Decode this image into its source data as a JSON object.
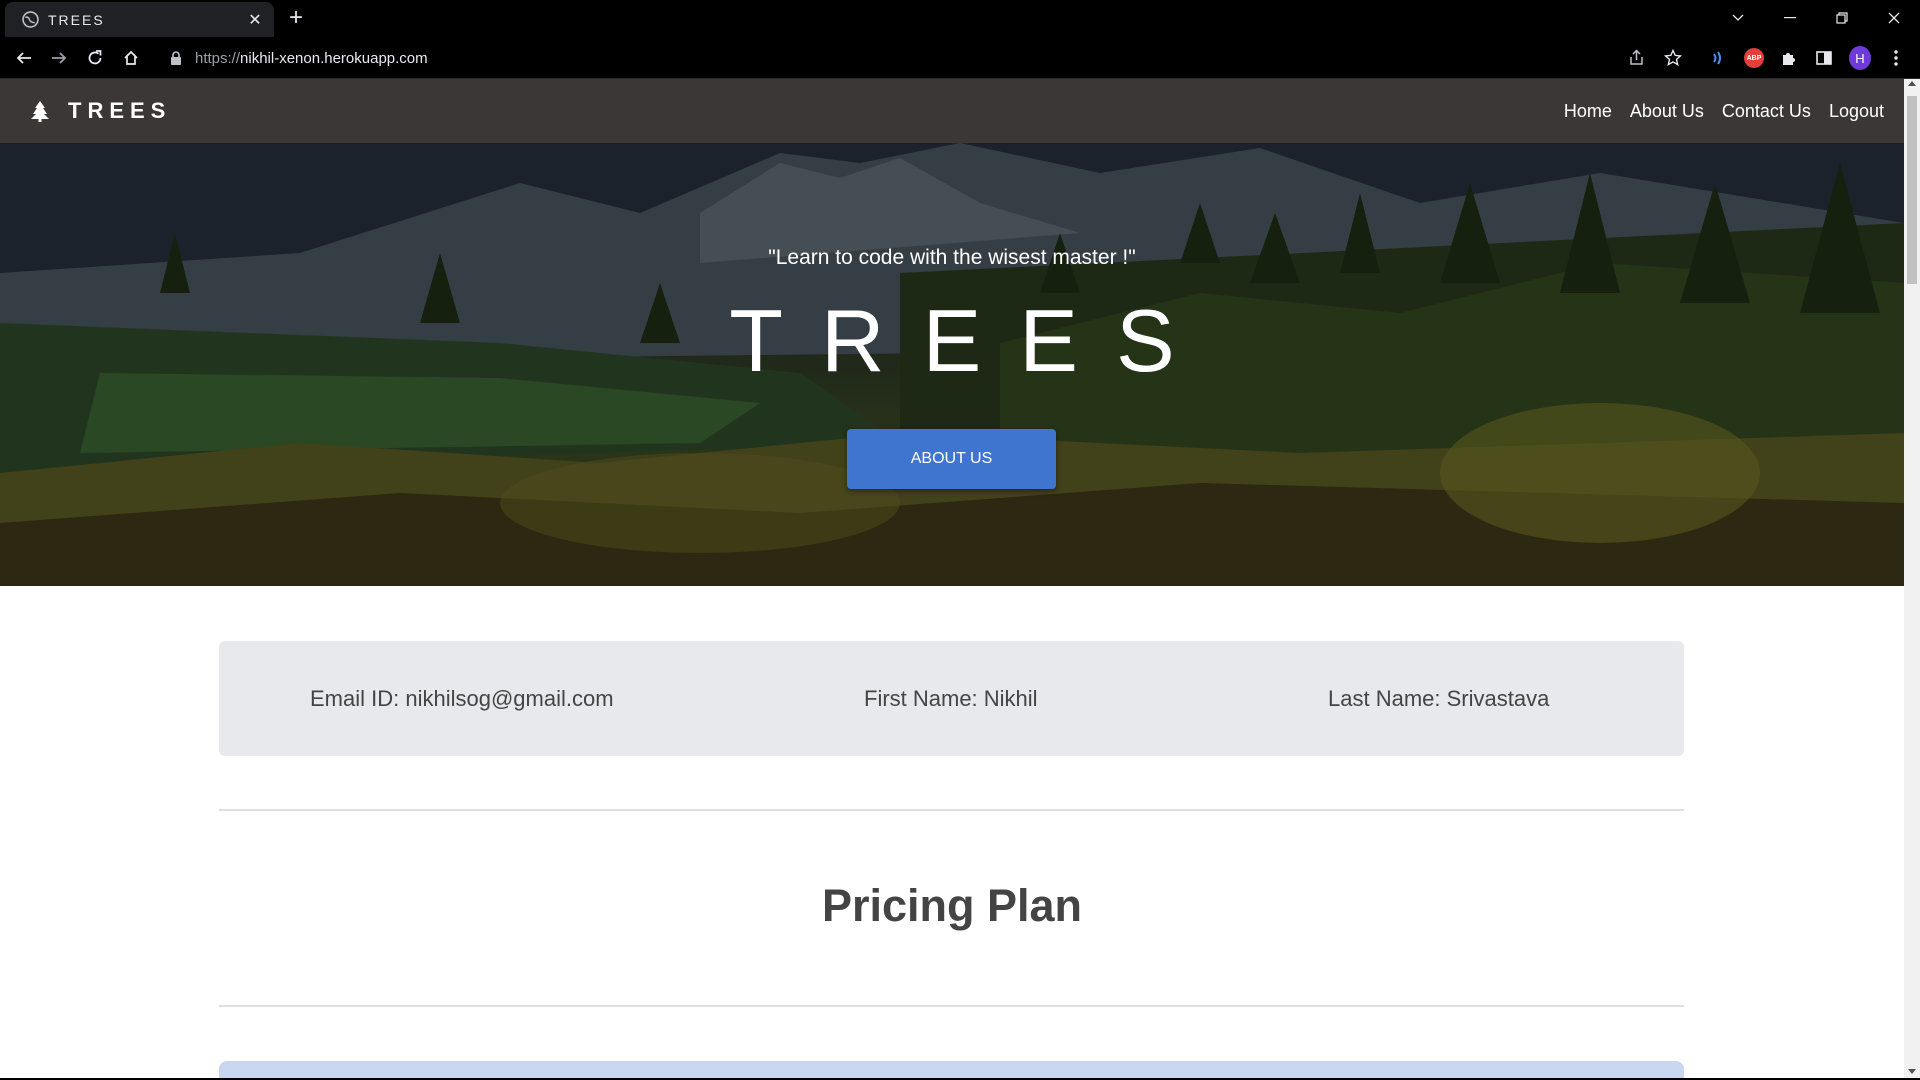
{
  "browser": {
    "tab_title": "TREES",
    "url_proto": "https://",
    "url_host": "nikhil-xenon.herokuapp.com",
    "profile_initial": "H",
    "abp_label": "ABP"
  },
  "site": {
    "brand": "TREES",
    "nav": [
      "Home",
      "About Us",
      "Contact Us",
      "Logout"
    ]
  },
  "hero": {
    "quote": "\"Learn to code with the wisest master !\"",
    "title": "TREES",
    "button": "ABOUT US"
  },
  "user": {
    "email": "Email ID: nikhilsog@gmail.com",
    "first_name": "First Name: Nikhil",
    "last_name": "Last Name: Srivastava"
  },
  "pricing": {
    "title": "Pricing Plan"
  },
  "colors": {
    "nav_bg": "#3b3736",
    "button": "#3f74cf",
    "info_card": "#e8e9ec"
  }
}
